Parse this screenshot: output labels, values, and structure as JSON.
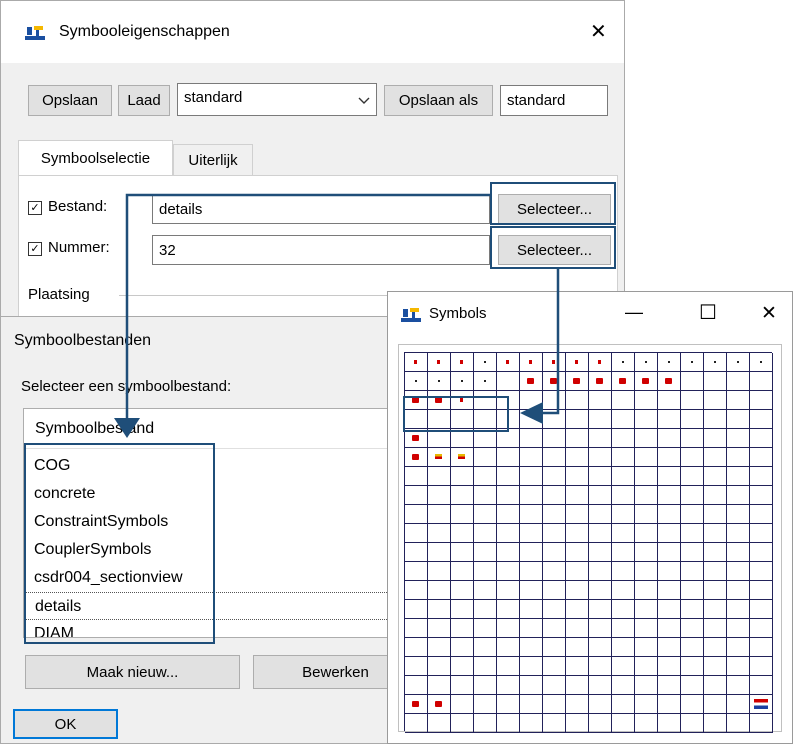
{
  "props_window": {
    "title": "Symbooleigenschappen",
    "close_glyph": "✕",
    "save_label": "Opslaan",
    "load_label": "Laad",
    "preset_value": "standard",
    "save_as_label": "Opslaan als",
    "save_as_value": "standard",
    "tabs": [
      "Symboolselectie",
      "Uiterlijk"
    ],
    "file_label": "Bestand:",
    "file_value": "details",
    "file_select_label": "Selecteer...",
    "number_label": "Nummer:",
    "number_value": "32",
    "number_select_label": "Selecteer...",
    "placement_label": "Plaatsing"
  },
  "files_dialog": {
    "title": "Symboolbestanden",
    "prompt": "Selecteer een symboolbestand:",
    "column_header": "Symboolbestand",
    "items": [
      "COG",
      "concrete",
      "ConstraintSymbols",
      "CouplerSymbols",
      "csdr004_sectionview",
      "details",
      "DIAM"
    ],
    "selected_item": "details",
    "new_label": "Maak nieuw...",
    "edit_label": "Bewerken",
    "ok_label": "OK"
  },
  "symbols_window": {
    "title": "Symbols",
    "minimize_glyph": "—",
    "maximize_glyph": "☐",
    "close_glyph": "✕",
    "grid": {
      "rows": 20,
      "cols": 16
    },
    "symbol_color": "#d00000"
  },
  "annotation_color": "#1f4e79",
  "icons": [
    "app-icon",
    "checkbox-checked-icon",
    "chevron-down-icon",
    "close-icon",
    "minimize-icon",
    "maximize-icon"
  ]
}
